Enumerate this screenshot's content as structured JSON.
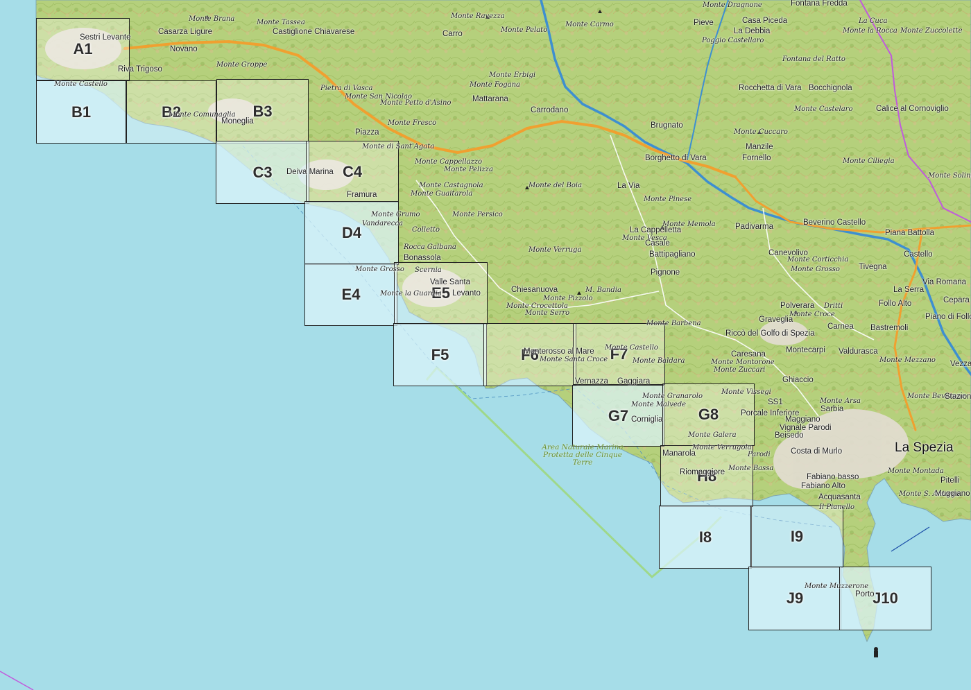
{
  "map": {
    "colors": {
      "sea": "#a6dde8",
      "land": "#b7d27f",
      "road_primary": "#f0a030",
      "river": "#3e8fd0",
      "park_boundary": "#9fd88a",
      "border": "#b04fd0",
      "grid_line": "#222222",
      "urban": "#e6e0d8"
    },
    "grid": [
      {
        "id": "A1"
      },
      {
        "id": "B1"
      },
      {
        "id": "B2"
      },
      {
        "id": "B3"
      },
      {
        "id": "C3"
      },
      {
        "id": "C4"
      },
      {
        "id": "D4"
      },
      {
        "id": "E4"
      },
      {
        "id": "E5"
      },
      {
        "id": "F5"
      },
      {
        "id": "F6"
      },
      {
        "id": "F7"
      },
      {
        "id": "G7"
      },
      {
        "id": "G8"
      },
      {
        "id": "H8"
      },
      {
        "id": "I8"
      },
      {
        "id": "I9"
      },
      {
        "id": "J9"
      },
      {
        "id": "J10"
      }
    ],
    "park_label": "Area Naturale Marina Protetta delle Cinque Terre",
    "labels": {
      "sestri_levante": "Sestri Levante",
      "casarza_ligure": "Casarza Ligure",
      "castiglione_chiavarese": "Castiglione Chiavarese",
      "novano": "Novano",
      "riva_trigoso": "Riva Trigoso",
      "monte_castello_a": "Monte Castello",
      "monte_brana": "Monte Brana",
      "monte_tassea": "Monte Tassea",
      "monte_groppe": "Monte Groppe",
      "monte_ravezza": "Monte Ravezza",
      "carro": "Carro",
      "monte_pelato": "Monte Pelato",
      "monte_carmo": "Monte Carmo",
      "monte_dragnone": "Monte Dragnone",
      "fontana_fredda": "Fontana Fredda",
      "pieve": "Pieve",
      "casa_piceda": "Casa Piceda",
      "la_debbia": "La Debbia",
      "poggio_castellaro": "Poggio Castellaro",
      "la_cuca": "La Cuca",
      "monte_la_rocca": "Monte la Rocca",
      "monte_zuccolette": "Monte Zuccolette",
      "fontana_del_ratto": "Fontana del Ratto",
      "monte_erbigi": "Monte Erbigi",
      "monte_fogana": "Monte Fogana",
      "pietra_di_vasca": "Pietra di Vasca",
      "monte_san_nicolao": "Monte San Nicolao",
      "monte_petto_asino": "Monte Petto d'Asino",
      "mattarana": "Mattarana",
      "carrodano": "Carrodano",
      "rocchetta_di_vara": "Rocchetta di Vara",
      "bocchignola": "Bocchignola",
      "monte_castelaro": "Monte Castelaro",
      "calice_al_cornoviglio": "Calice al Cornoviglio",
      "moneglia": "Moneglia",
      "monte_comunaglia": "Monte Comunaglia",
      "monte_fresco": "Monte Fresco",
      "piazza": "Piazza",
      "brugnato": "Brugnato",
      "monte_cuccaro": "Monte Cuccaro",
      "manzile": "Manzile",
      "fornello": "Fornello",
      "monte_di_santagata": "Monte di Sant'Agata",
      "monte_cappellazzo": "Monte Cappellazzo",
      "monte_pelizza": "Monte Pelizza",
      "borghetto_di_vara": "Borghetto di Vara",
      "monte_ciliegia": "Monte Ciliegia",
      "monte_solini": "Monte Solini",
      "deiva_marina": "Deiva Marina",
      "monte_castagnola": "Monte Castagnola",
      "monte_guaitarola": "Monte Guaitarola",
      "monte_del_boia": "Monte del Boia",
      "la_via": "La Via",
      "framura": "Framura",
      "monte_pinese": "Monte Pinese",
      "monte_grumo": "Monte Grumo",
      "vandarecca": "Vandarecca",
      "monte_persico": "Monte Persico",
      "beverino_castello": "Beverino Castello",
      "padivarma": "Padivarma",
      "monte_memola": "Monte Memola",
      "colletto": "Colletto",
      "la_cappelletta": "La Cappelletta",
      "monte_vesca": "Monte Vesca",
      "casale": "Casale",
      "piana_battolla": "Piana Battolla",
      "rocca_galbana": "Rocca Galbana",
      "monte_verruga": "Monte Verruga",
      "battipagliano": "Battipagliano",
      "canevolivo": "Canevolivo",
      "bonassola": "Bonassola",
      "monte_corticchia": "Monte Corticchia",
      "castello": "Castello",
      "scernia": "Scernia",
      "monte_grosso": "Monte Grosso",
      "tivegna": "Tivegna",
      "pignone": "Pignone",
      "valle_santa": "Valle Santa",
      "levanto": "Levanto",
      "via_romana": "Via Romana",
      "chiesanuova": "Chiesanuova",
      "m_bandia": "M. Bandia",
      "monte_pizzolo": "Monte Pizzolo",
      "la_serra": "La Serra",
      "monte_la_guardia": "Monte la Guardia",
      "cepara": "Cepara",
      "monte_crocettola": "Monte Crocettola",
      "polverara": "Polverara",
      "dritti": "Dritti",
      "follo_alto": "Follo Alto",
      "monte_serro": "Monte Serro",
      "monte_croce": "Monte Croce",
      "piano_di_follo": "Piano di Follo",
      "monte_barbena": "Monte Barbena",
      "graveglia": "Graveglia",
      "carnea": "Carnea",
      "bastremoli": "Bastremoli",
      "monterosso_al_mare": "Monterosso al Mare",
      "monte_castello_f": "Monte Castello",
      "monte_santa_croce": "Monte Santa Croce",
      "ricco_del_golfo": "Riccò del Golfo di Spezia",
      "monte_baldara": "Monte Baldara",
      "montecarpi": "Montecarpi",
      "valdurasca": "Valdurasca",
      "caresana": "Caresana",
      "monte_montorone": "Monte Montorone",
      "monte_mezzano": "Monte Mezzano",
      "vezza": "Vezza",
      "monte_zuccari": "Monte Zuccari",
      "vernazza": "Vernazza",
      "gaggiara": "Gaggiara",
      "ghiaccio": "Ghiaccio",
      "monte_vissegi": "Monte Vissegi",
      "ss1": "SS1",
      "monte_arsa": "Monte Arsa",
      "sarbia": "Sarbia",
      "monte_beverone": "Monte Beverone",
      "stazione": "Stazione",
      "monte_granarolo": "Monte Granarolo",
      "monte_malvede": "Monte Malvede",
      "porcale_inferiore": "Porcale Inferiore",
      "maggiano": "Maggiano",
      "corniglia": "Corniglia",
      "vignale_parodi": "Vignale Parodi",
      "beisedo": "Beisedo",
      "monte_galera": "Monte Galera",
      "la_spezia": "La Spezia",
      "costa_di_murlo": "Costa di Murlo",
      "manarola": "Manarola",
      "monte_verrugola": "Monte Verrugola",
      "parodi": "Parodi",
      "fabiano_basso": "Fabiano basso",
      "monte_montada": "Monte Montada",
      "monte_bassa": "Monte Bassa",
      "fabiano_alto": "Fabiano Alto",
      "riomaggiore": "Riomaggiore",
      "acquasanta": "Acquasanta",
      "pitelli": "Pitelli",
      "il_pianello": "Il Pianello",
      "monte_santantonio": "Monte S. Antonio",
      "muggiano": "Muggiano",
      "monte_muzzerone": "Monte Muzzerone",
      "porto": "Porto"
    }
  }
}
